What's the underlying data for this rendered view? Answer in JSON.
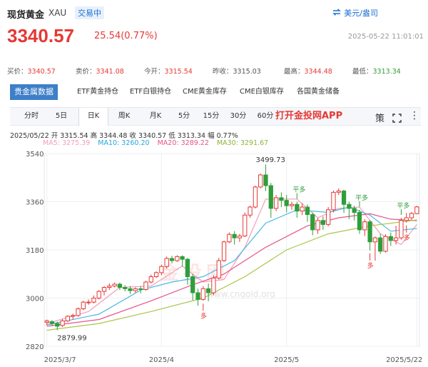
{
  "header": {
    "title": "现货黄金",
    "code": "XAU",
    "trading_status": "交易中",
    "unit_switch": "美元/盎司"
  },
  "price": {
    "last": "3340.57",
    "change": "25.54(0.77%)",
    "timestamp": "2025-05-22 11:01:01"
  },
  "quote": {
    "bid_label": "买价：",
    "bid": "3340.57",
    "ask_label": "卖价：",
    "ask": "3341.08",
    "open_label": "今开：",
    "open": "3315.54",
    "prev_close_label": "昨收：",
    "prev_close": "3315.03",
    "high_label": "最高：",
    "high": "3344.48",
    "low_label": "最低：",
    "low": "3313.34"
  },
  "data_tabs": [
    "贵金属数据",
    "ETF黄金持仓",
    "ETF白银持仓",
    "CME黄金库存",
    "CME白银库存",
    "各国黄金储备"
  ],
  "periods": [
    "分时",
    "5日",
    "日K",
    "周K",
    "月K",
    "5分",
    "15分",
    "30分",
    "60分"
  ],
  "active_period": "日K",
  "promo": "打开金投网APP",
  "strategy_label": "策",
  "ohlc": {
    "text": "2025/05/22  开 3315.54  高 3344.48  收 3340.57  低 3313.34  幅 0.77%"
  },
  "ma": {
    "ma5": "MA5: 3275.39",
    "ma10": "MA10: 3260.20",
    "ma20": "MA20: 3289.22",
    "ma30": "MA30: 3291.67"
  },
  "colors": {
    "up": "#e53935",
    "down": "#2e9e3a",
    "ma5": "#f3a0b5",
    "ma10": "#4ab8e6",
    "ma20": "#e8528a",
    "ma30": "#a8c64a"
  },
  "chart_data": {
    "type": "candlestick",
    "y_ticks": [
      3540,
      3360,
      3180,
      3000,
      2820
    ],
    "x_ticks": [
      "2025/3/7",
      "2025/4",
      "2025/5",
      "2025/5/22"
    ],
    "ylim": [
      2820,
      3540
    ],
    "annotations": {
      "max_label": "3499.73",
      "min_label": "2879.99",
      "signals": [
        {
          "text": "平多",
          "day": 48
        },
        {
          "text": "多",
          "day": 30
        },
        {
          "text": "平多",
          "day": 60
        },
        {
          "text": "多",
          "day": 62
        },
        {
          "text": "平多",
          "day": 68
        },
        {
          "text": "多",
          "day": 69
        }
      ]
    },
    "candles": [
      [
        2910,
        2915,
        2898,
        2920
      ],
      [
        2912,
        2905,
        2895,
        2918
      ],
      [
        2905,
        2895,
        2880,
        2912
      ],
      [
        2898,
        2915,
        2892,
        2922
      ],
      [
        2915,
        2932,
        2910,
        2936
      ],
      [
        2932,
        2935,
        2920,
        2942
      ],
      [
        2935,
        2960,
        2930,
        2965
      ],
      [
        2960,
        2985,
        2955,
        2990
      ],
      [
        2985,
        2985,
        2975,
        2995
      ],
      [
        2985,
        3000,
        2980,
        3010
      ],
      [
        3000,
        3025,
        2995,
        3030
      ],
      [
        3025,
        3040,
        3010,
        3045
      ],
      [
        3040,
        3045,
        3030,
        3055
      ],
      [
        3045,
        3052,
        3040,
        3058
      ],
      [
        3052,
        3040,
        3030,
        3058
      ],
      [
        3040,
        3035,
        3025,
        3048
      ],
      [
        3035,
        3028,
        3015,
        3045
      ],
      [
        3028,
        3035,
        3020,
        3040
      ],
      [
        3035,
        3032,
        3018,
        3045
      ],
      [
        3032,
        3060,
        3028,
        3065
      ],
      [
        3060,
        3080,
        3055,
        3088
      ],
      [
        3080,
        3095,
        3075,
        3100
      ],
      [
        3095,
        3118,
        3085,
        3125
      ],
      [
        3118,
        3148,
        3110,
        3155
      ],
      [
        3148,
        3140,
        3130,
        3158
      ],
      [
        3140,
        3155,
        3135,
        3160
      ],
      [
        3155,
        3145,
        3118,
        3160
      ],
      [
        3145,
        3080,
        3050,
        3150
      ],
      [
        3080,
        3020,
        2992,
        3090
      ],
      [
        3020,
        2995,
        2972,
        3035
      ],
      [
        2995,
        3035,
        2990,
        3045
      ],
      [
        3035,
        3020,
        2988,
        3055
      ],
      [
        3020,
        3075,
        3010,
        3085
      ],
      [
        3075,
        3140,
        3070,
        3150
      ],
      [
        3140,
        3210,
        3135,
        3215
      ],
      [
        3210,
        3238,
        3205,
        3245
      ],
      [
        3238,
        3225,
        3200,
        3250
      ],
      [
        3225,
        3232,
        3210,
        3240
      ],
      [
        3232,
        3310,
        3228,
        3320
      ],
      [
        3310,
        3340,
        3300,
        3345
      ],
      [
        3340,
        3415,
        3335,
        3420
      ],
      [
        3415,
        3460,
        3410,
        3465
      ],
      [
        3460,
        3420,
        3400,
        3499
      ],
      [
        3420,
        3335,
        3300,
        3430
      ],
      [
        3335,
        3375,
        3325,
        3385
      ],
      [
        3375,
        3365,
        3340,
        3395
      ],
      [
        3365,
        3345,
        3320,
        3385
      ],
      [
        3345,
        3350,
        3330,
        3360
      ],
      [
        3350,
        3325,
        3300,
        3360
      ],
      [
        3325,
        3340,
        3310,
        3355
      ],
      [
        3340,
        3312,
        3285,
        3350
      ],
      [
        3312,
        3255,
        3235,
        3320
      ],
      [
        3255,
        3290,
        3240,
        3300
      ],
      [
        3290,
        3275,
        3255,
        3305
      ],
      [
        3275,
        3330,
        3268,
        3340
      ],
      [
        3330,
        3395,
        3320,
        3402
      ],
      [
        3395,
        3400,
        3385,
        3410
      ],
      [
        3400,
        3350,
        3318,
        3405
      ],
      [
        3350,
        3335,
        3295,
        3360
      ],
      [
        3335,
        3320,
        3290,
        3345
      ],
      [
        3320,
        3255,
        3240,
        3330
      ],
      [
        3255,
        3285,
        3232,
        3295
      ],
      [
        3285,
        3210,
        3178,
        3292
      ],
      [
        3210,
        3225,
        3140,
        3230
      ],
      [
        3225,
        3175,
        3165,
        3240
      ],
      [
        3175,
        3230,
        3170,
        3238
      ],
      [
        3230,
        3215,
        3195,
        3245
      ],
      [
        3215,
        3225,
        3200,
        3270
      ],
      [
        3225,
        3290,
        3218,
        3300
      ],
      [
        3290,
        3300,
        3282,
        3318
      ],
      [
        3300,
        3316,
        3292,
        3322
      ],
      [
        3315.54,
        3340.57,
        3313.34,
        3344.48
      ]
    ],
    "ma_series": {
      "ma5": [
        [
          0,
          2905
        ],
        [
          8,
          2950
        ],
        [
          14,
          3040
        ],
        [
          20,
          3045
        ],
        [
          26,
          3120
        ],
        [
          30,
          3060
        ],
        [
          34,
          3070
        ],
        [
          38,
          3190
        ],
        [
          42,
          3370
        ],
        [
          48,
          3370
        ],
        [
          52,
          3300
        ],
        [
          56,
          3335
        ],
        [
          60,
          3340
        ],
        [
          64,
          3240
        ],
        [
          68,
          3200
        ],
        [
          71,
          3275
        ]
      ],
      "ma10": [
        [
          0,
          2900
        ],
        [
          10,
          2940
        ],
        [
          18,
          3030
        ],
        [
          24,
          3060
        ],
        [
          30,
          3080
        ],
        [
          36,
          3140
        ],
        [
          42,
          3280
        ],
        [
          48,
          3330
        ],
        [
          54,
          3320
        ],
        [
          58,
          3340
        ],
        [
          62,
          3310
        ],
        [
          66,
          3250
        ],
        [
          71,
          3260
        ]
      ],
      "ma20": [
        [
          0,
          2895
        ],
        [
          10,
          2920
        ],
        [
          20,
          2990
        ],
        [
          28,
          3050
        ],
        [
          34,
          3090
        ],
        [
          42,
          3190
        ],
        [
          50,
          3270
        ],
        [
          56,
          3300
        ],
        [
          62,
          3315
        ],
        [
          66,
          3295
        ],
        [
          71,
          3289
        ]
      ],
      "ma30": [
        [
          0,
          2880
        ],
        [
          10,
          2905
        ],
        [
          20,
          2950
        ],
        [
          30,
          3000
        ],
        [
          38,
          3080
        ],
        [
          46,
          3180
        ],
        [
          54,
          3240
        ],
        [
          62,
          3270
        ],
        [
          71,
          3292
        ]
      ]
    }
  }
}
